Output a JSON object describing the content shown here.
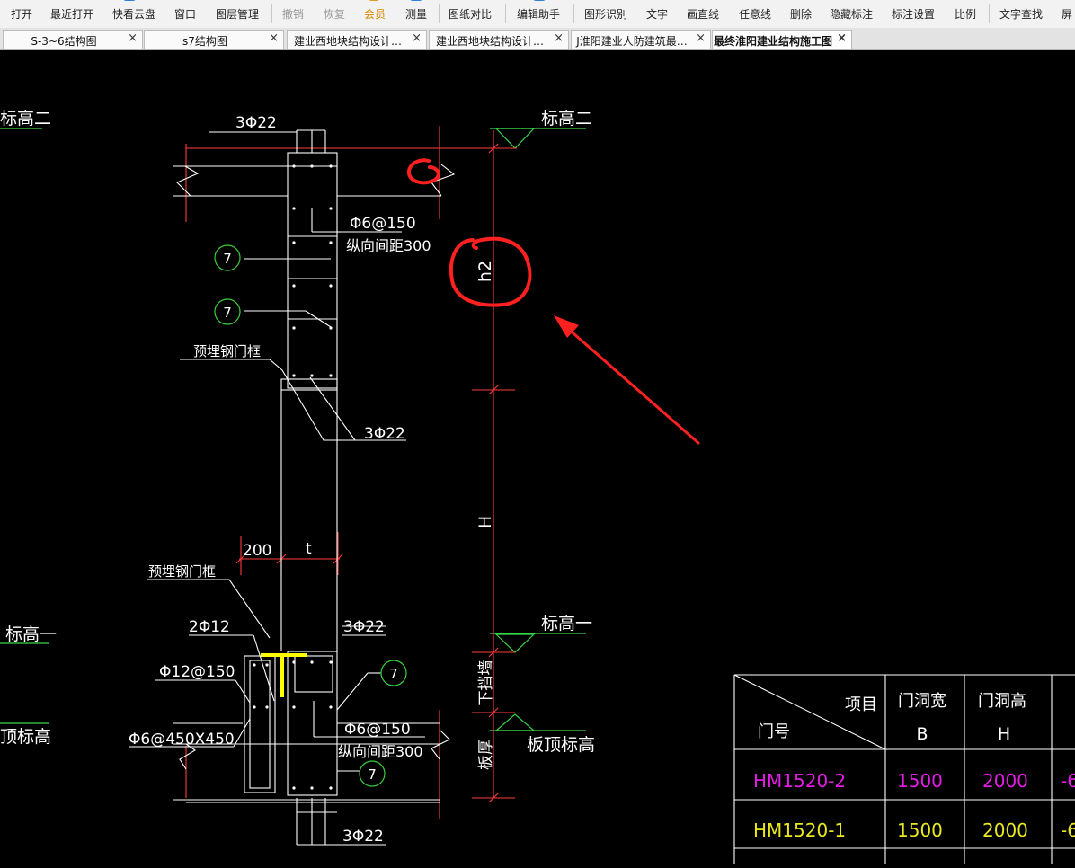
{
  "toolbar": {
    "open": "打开",
    "recent": "最近打开",
    "cloud": "快看云盘",
    "window": "窗口",
    "layers": "图层管理",
    "undo": "撤销",
    "redo": "恢复",
    "member": "会员",
    "measure": "测量",
    "compare": "图纸对比",
    "edit_assistant": "编辑助手",
    "shape_recognize": "图形识别",
    "text": "文字",
    "draw_line": "画直线",
    "free_line": "任意线",
    "delete": "删除",
    "hide_marks": "隐藏标注",
    "mark_settings": "标注设置",
    "scale": "比例",
    "text_search": "文字查找",
    "screen": "屏"
  },
  "tabs": [
    {
      "label": "S-3~6结构图",
      "active": false
    },
    {
      "label": "s7结构图",
      "active": false
    },
    {
      "label": "建业西地块结构设计…",
      "active": false
    },
    {
      "label": "建业西地块结构设计…",
      "active": false
    },
    {
      "label": "J淮阳建业人防建筑最…",
      "active": false
    },
    {
      "label": "最终淮阳建业结构施工图",
      "active": true
    }
  ],
  "tab_close": "×",
  "drawing": {
    "colors": {
      "background": "#000000",
      "dim_line": "#ff3b3b",
      "outline": "#ffffff",
      "elevation": "#39d54a",
      "callout": "#3bcf3b",
      "markup": "#ff2020",
      "embed": "#ffff00",
      "table_magenta": "#e31ce3",
      "table_yellow": "#e8e820"
    },
    "elev2_left": "标高二",
    "elev2_right": "标高二",
    "elev1_left": "标高一",
    "elev1_right": "标高一",
    "slab_top_left": "顶标高",
    "slab_top_right": "板顶标高",
    "top_bars": "3Φ22",
    "stirrup_top": "Φ6@150",
    "spacing_top": "纵向间距300",
    "callout_num": "7",
    "embedded_frame_top": "预埋钢门框",
    "mid_bars": "3Φ22",
    "h2": "h2",
    "H": "H",
    "dim_200": "200",
    "dim_t": "t",
    "embedded_frame_bottom": "预埋钢门框",
    "bars_2phi12": "2Φ12",
    "bars_3phi22_lower": "3Φ22",
    "stirrup_phi12": "Φ12@150",
    "stirrup_lower": "Φ6@150",
    "spacing_lower": "纵向间距300",
    "grid_phi6": "Φ6@450X450",
    "lower_wall": "下挡墙",
    "slab_thick": "板厚",
    "bottom_bars": "3Φ22"
  },
  "table": {
    "header_item": "项目",
    "header_door_no": "门号",
    "col_width": "门洞宽",
    "col_width_sym": "B",
    "col_height": "门洞高",
    "col_height_sym": "H",
    "rows": [
      {
        "id": "HM1520-2",
        "b": "1500",
        "h": "2000",
        "extra": "-6",
        "color": "magenta"
      },
      {
        "id": "HM1520-1",
        "b": "1500",
        "h": "2000",
        "extra": "-6",
        "color": "yellow"
      }
    ]
  }
}
